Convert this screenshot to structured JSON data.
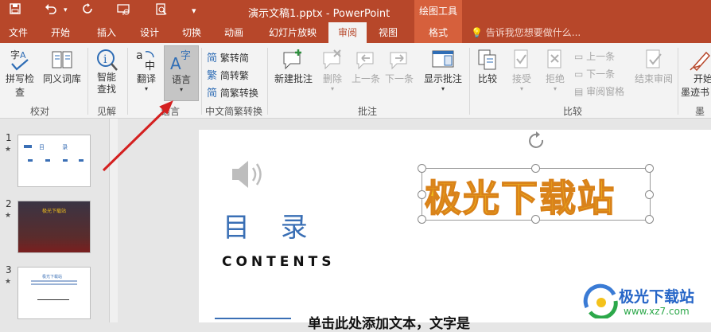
{
  "window": {
    "title": "演示文稿1.pptx - PowerPoint",
    "context_tools": "绘图工具"
  },
  "tabs": [
    "文件",
    "开始",
    "插入",
    "设计",
    "切换",
    "动画",
    "幻灯片放映",
    "审阅",
    "视图",
    "格式"
  ],
  "active_tab": "审阅",
  "tell_me": "告诉我您想要做什么...",
  "ribbon": {
    "groups": {
      "proofing": "校对",
      "insights": "见解",
      "language": "语言",
      "chinese_conversion": "中文简繁转换",
      "comments": "批注",
      "compare": "比较",
      "ink": "墨迹"
    },
    "buttons": {
      "spelling": "拼写检查",
      "thesaurus": "同义词库",
      "smart_lookup": "智能\n查找",
      "translate": "翻译",
      "language": "语言",
      "trad_to_simp": "繁转简",
      "simp_to_trad": "简转繁",
      "convert": "简繁转换",
      "new_comment": "新建批注",
      "delete": "删除",
      "previous": "上一条",
      "next": "下一条",
      "show_comments": "显示批注",
      "compare": "比较",
      "accept": "接受",
      "reject": "拒绝",
      "prev_change": "上一条",
      "next_change": "下一条",
      "reviewing_pane": "审阅窗格",
      "end_review": "结束审阅",
      "start_ink": "开始",
      "ink_sub": "墨迹书"
    }
  },
  "thumbnails": [
    {
      "num": "1",
      "star": "★",
      "text": "目 录"
    },
    {
      "num": "2",
      "star": "★",
      "text": "极光下载站"
    },
    {
      "num": "3",
      "star": "★",
      "text": "极光下载站"
    }
  ],
  "slide": {
    "heading": "目 录",
    "subheading": "CONTENTS",
    "wordart": "极光下载站",
    "bottom_text": "单击此处添加文本，文字是"
  },
  "watermark": {
    "name": "极光下载站",
    "url": "www.xz7.com"
  },
  "colors": {
    "ribbon_accent": "#b7472a",
    "context_tab": "#d6603c",
    "heading_blue": "#3a6fb5",
    "wordart_fill": "#f4c21b",
    "wordart_outline": "#d9821a",
    "arrow_red": "#d42020"
  }
}
